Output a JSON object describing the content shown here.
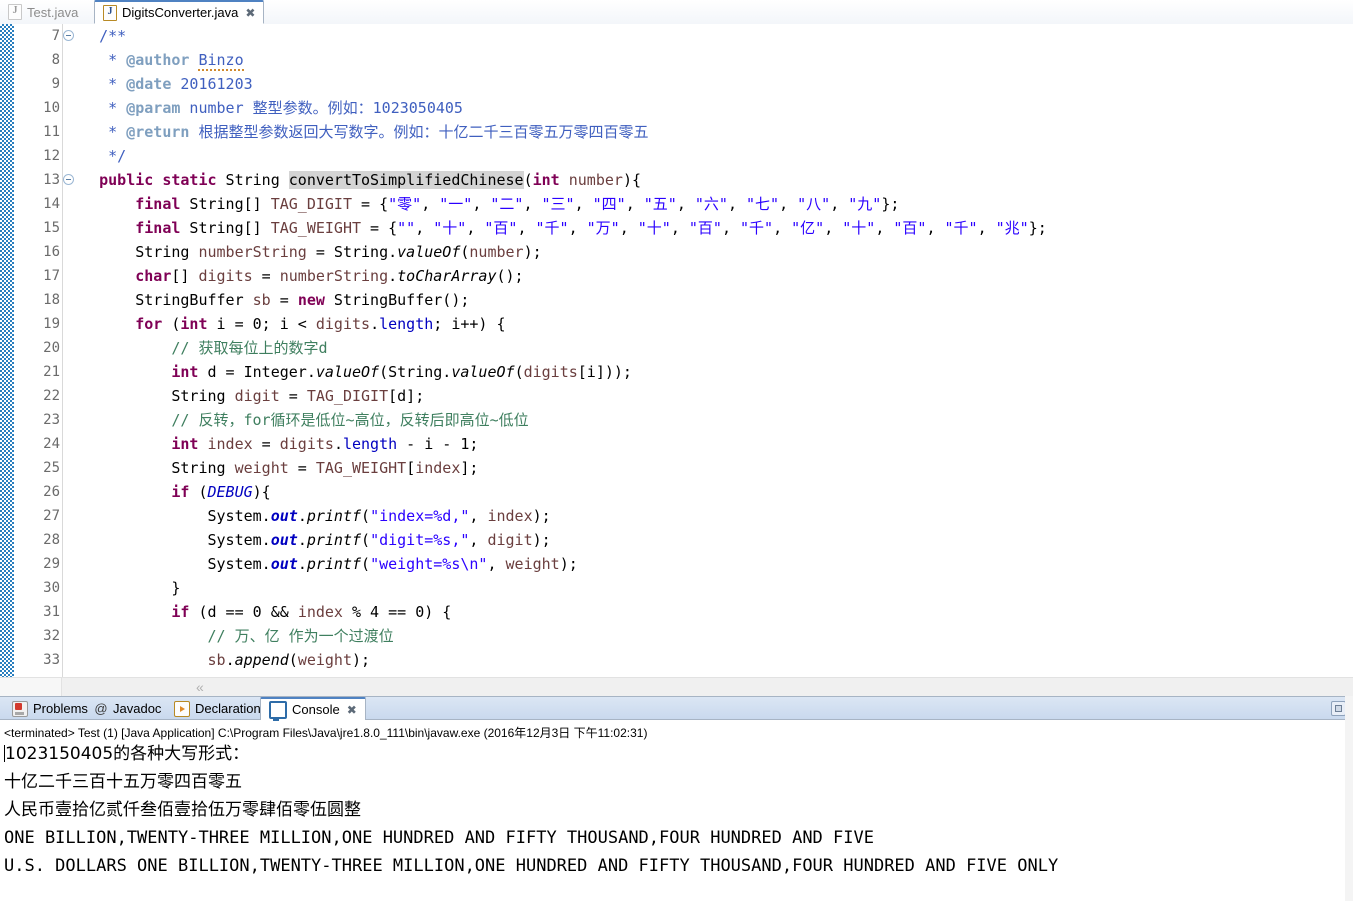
{
  "editor_tabs": [
    {
      "label": "Test.java",
      "icon": "java-file-icon",
      "active": false,
      "closeable": false
    },
    {
      "label": "DigitsConverter.java",
      "icon": "java-file-icon",
      "active": true,
      "closeable": true,
      "close_glyph": "✖"
    }
  ],
  "code": {
    "first_line_number": 7,
    "lines": [
      {
        "n": 7,
        "fold": true,
        "text": "    /**"
      },
      {
        "n": 8,
        "fold": false,
        "text": "     * @author Binzo"
      },
      {
        "n": 9,
        "fold": false,
        "text": "     * @date 20161203"
      },
      {
        "n": 10,
        "fold": false,
        "text": "     * @param number 整型参数。例如：1023050405"
      },
      {
        "n": 11,
        "fold": false,
        "text": "     * @return 根据整型参数返回大写数字。例如：十亿二千三百零五万零四百零五"
      },
      {
        "n": 12,
        "fold": false,
        "text": "     */"
      },
      {
        "n": 13,
        "fold": true,
        "text": "    public static String convertToSimplifiedChinese(int number){"
      },
      {
        "n": 14,
        "fold": false,
        "text": "        final String[] TAG_DIGIT = {\"零\", \"一\", \"二\", \"三\", \"四\", \"五\", \"六\", \"七\", \"八\", \"九\"};"
      },
      {
        "n": 15,
        "fold": false,
        "text": "        final String[] TAG_WEIGHT = {\"\", \"十\", \"百\", \"千\", \"万\", \"十\", \"百\", \"千\", \"亿\", \"十\", \"百\", \"千\", \"兆\"};"
      },
      {
        "n": 16,
        "fold": false,
        "text": "        String numberString = String.valueOf(number);"
      },
      {
        "n": 17,
        "fold": false,
        "text": "        char[] digits = numberString.toCharArray();"
      },
      {
        "n": 18,
        "fold": false,
        "text": "        StringBuffer sb = new StringBuffer();"
      },
      {
        "n": 19,
        "fold": false,
        "text": "        for (int i = 0; i < digits.length; i++) {"
      },
      {
        "n": 20,
        "fold": false,
        "text": "            // 获取每位上的数字d"
      },
      {
        "n": 21,
        "fold": false,
        "text": "            int d = Integer.valueOf(String.valueOf(digits[i]));"
      },
      {
        "n": 22,
        "fold": false,
        "text": "            String digit = TAG_DIGIT[d];"
      },
      {
        "n": 23,
        "fold": false,
        "text": "            // 反转，for循环是低位~高位，反转后即高位~低位"
      },
      {
        "n": 24,
        "fold": false,
        "text": "            int index = digits.length - i - 1;"
      },
      {
        "n": 25,
        "fold": false,
        "text": "            String weight = TAG_WEIGHT[index];"
      },
      {
        "n": 26,
        "fold": false,
        "text": "            if (DEBUG){"
      },
      {
        "n": 27,
        "fold": false,
        "text": "                System.out.printf(\"index=%d,\", index);"
      },
      {
        "n": 28,
        "fold": false,
        "text": "                System.out.printf(\"digit=%s,\", digit);"
      },
      {
        "n": 29,
        "fold": false,
        "text": "                System.out.printf(\"weight=%s\\n\", weight);"
      },
      {
        "n": 30,
        "fold": false,
        "text": "            }"
      },
      {
        "n": 31,
        "fold": false,
        "text": "            if (d == 0 && index % 4 == 0) {"
      },
      {
        "n": 32,
        "fold": false,
        "text": "                // 万、亿 作为一个过渡位"
      },
      {
        "n": 33,
        "fold": false,
        "text": "                sb.append(weight);"
      }
    ],
    "highlighted_token": "convertToSimplifiedChinese",
    "spellcheck_underlined": "Binzo"
  },
  "editor_scrollbar": {
    "left_chevron": "«"
  },
  "bottom_view": {
    "tabs": [
      {
        "label": "Problems",
        "icon": "problems-icon",
        "active": false
      },
      {
        "label": "Javadoc",
        "icon": "javadoc-at-icon",
        "active": false
      },
      {
        "label": "Declaration",
        "icon": "declaration-icon",
        "active": false
      },
      {
        "label": "Console",
        "icon": "console-icon",
        "active": true,
        "close_glyph": "✖"
      }
    ],
    "maximize_tooltip": "Maximize",
    "terminated_line": "<terminated> Test (1) [Java Application] C:\\Program Files\\Java\\jre1.8.0_111\\bin\\javaw.exe (2016年12月3日 下午11:02:31)",
    "output_lines": [
      {
        "text": "1023150405的各种大写形式：",
        "style": "cjk",
        "caret": true
      },
      {
        "text": "十亿二千三百十五万零四百零五",
        "style": "cjk",
        "caret": false
      },
      {
        "text": "人民币壹拾亿贰仟叁佰壹拾伍万零肆佰零伍圆整",
        "style": "cjk",
        "caret": false
      },
      {
        "text": "ONE BILLION,TWENTY-THREE MILLION,ONE HUNDRED AND FIFTY THOUSAND,FOUR HUNDRED AND FIVE",
        "style": "mono",
        "caret": false
      },
      {
        "text": "U.S. DOLLARS ONE BILLION,TWENTY-THREE MILLION,ONE HUNDRED AND FIFTY THOUSAND,FOUR HUNDRED AND FIVE ONLY",
        "style": "mono",
        "caret": false
      }
    ]
  },
  "colors": {
    "keyword": "#7f0055",
    "string": "#2a00ff",
    "comment": "#3f7f5f",
    "javadoc": "#3f5fbf",
    "javadoc_tag": "#7f9fbf",
    "static_field": "#0000c0",
    "parameter": "#6a3e3e",
    "tab_accent": "#4f82c2",
    "change_bar": "#2a7fbf"
  }
}
